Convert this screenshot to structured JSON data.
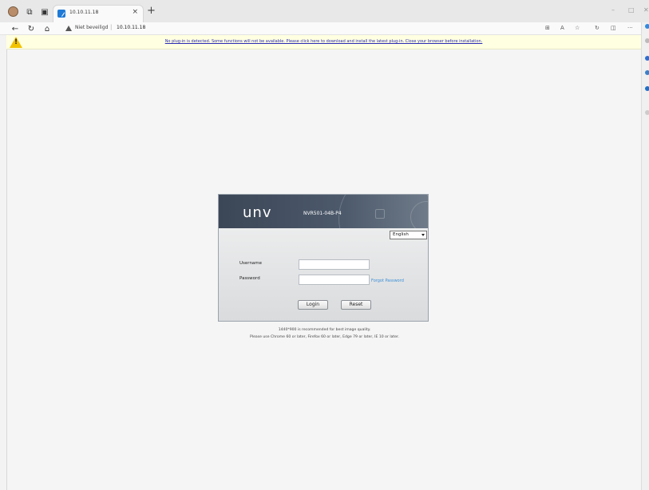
{
  "browser": {
    "tab_title": "10.10.11.18",
    "tab_close": "×",
    "new_tab": "+",
    "security_label": "Niet beveiligd",
    "url": "10.10.11.18",
    "separator": "|",
    "win_min": "–",
    "win_max": "□",
    "win_close": "✕"
  },
  "infobar": {
    "message": "No plug-in is detected. Some functions will not be available. Please click here to download and install the latest plug-in. Close your browser before installation."
  },
  "login": {
    "logo": "unv",
    "model": "NVR501-04B-P4",
    "language": "English",
    "username_label": "Username",
    "password_label": "Password",
    "forgot_password": "Forgot Password",
    "login_button": "Login",
    "reset_button": "Reset"
  },
  "notes": {
    "line1": "1440*900 is recommended for best image quality.",
    "line2": "Please use Chrome 60 or later, Firefox 60 or later, Edge 79 or later, IE 10 or later."
  }
}
